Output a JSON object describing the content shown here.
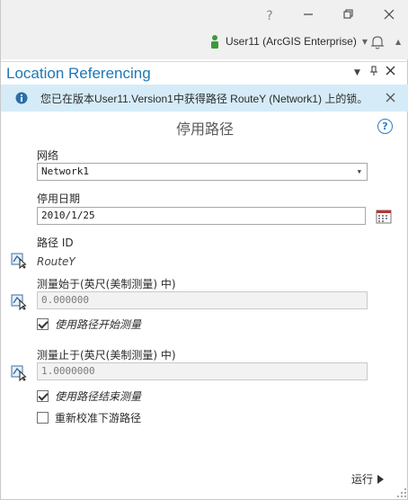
{
  "window": {
    "help_glyph": "?",
    "user_label": "User11 (ArcGIS Enterprise)"
  },
  "pane": {
    "title": "Location Referencing"
  },
  "banner": {
    "message": "您已在版本User11.Version1中获得路径 RouteY (Network1) 上的锁。"
  },
  "tool": {
    "title": "停用路径",
    "help_glyph": "?"
  },
  "form": {
    "network_label": "网络",
    "network_value": "Network1",
    "retire_date_label": "停用日期",
    "retire_date_value": "2010/1/25",
    "route_id_label": "路径 ID",
    "route_id_value": "RouteY",
    "from_measure_label": "测量始于(英尺(美制测量) 中)",
    "from_measure_value": "0.000000",
    "use_route_start_label": "使用路径开始测量",
    "use_route_start_checked": true,
    "to_measure_label": "测量止于(英尺(美制测量) 中)",
    "to_measure_value": "1.0000000",
    "use_route_end_label": "使用路径结束测量",
    "use_route_end_checked": true,
    "recalibrate_label": "重新校准下游路径",
    "recalibrate_checked": false
  },
  "actions": {
    "run_label": "运行"
  },
  "colors": {
    "accent": "#1f78b4",
    "banner_bg": "#d5ecf8",
    "help": "#2e7dc6"
  }
}
